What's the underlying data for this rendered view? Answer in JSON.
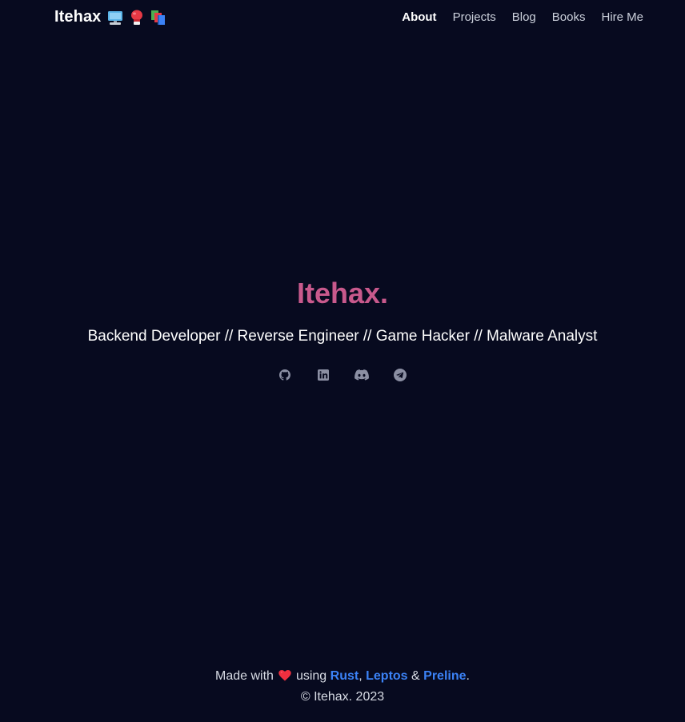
{
  "header": {
    "brand": "Itehax",
    "brand_icons": [
      "desktop-computer-icon",
      "boxing-glove-icon",
      "books-icon"
    ],
    "nav": [
      {
        "label": "About",
        "active": true
      },
      {
        "label": "Projects",
        "active": false
      },
      {
        "label": "Blog",
        "active": false
      },
      {
        "label": "Books",
        "active": false
      },
      {
        "label": "Hire Me",
        "active": false
      }
    ]
  },
  "hero": {
    "title": "Itehax.",
    "subtitle": "Backend Developer // Reverse Engineer // Game Hacker // Malware Analyst",
    "socials": [
      "github-icon",
      "linkedin-icon",
      "discord-icon",
      "telegram-icon"
    ]
  },
  "footer": {
    "made_with": "Made with",
    "using": "using",
    "rust": "Rust",
    "comma": ",",
    "leptos": "Leptos",
    "amp": "&",
    "preline": "Preline",
    "period": ".",
    "copyright": "© Itehax. 2023"
  },
  "colors": {
    "background": "#070a1f",
    "accent_title": "#c8598c",
    "link": "#3b82f6",
    "icon": "#8b8fa3"
  }
}
